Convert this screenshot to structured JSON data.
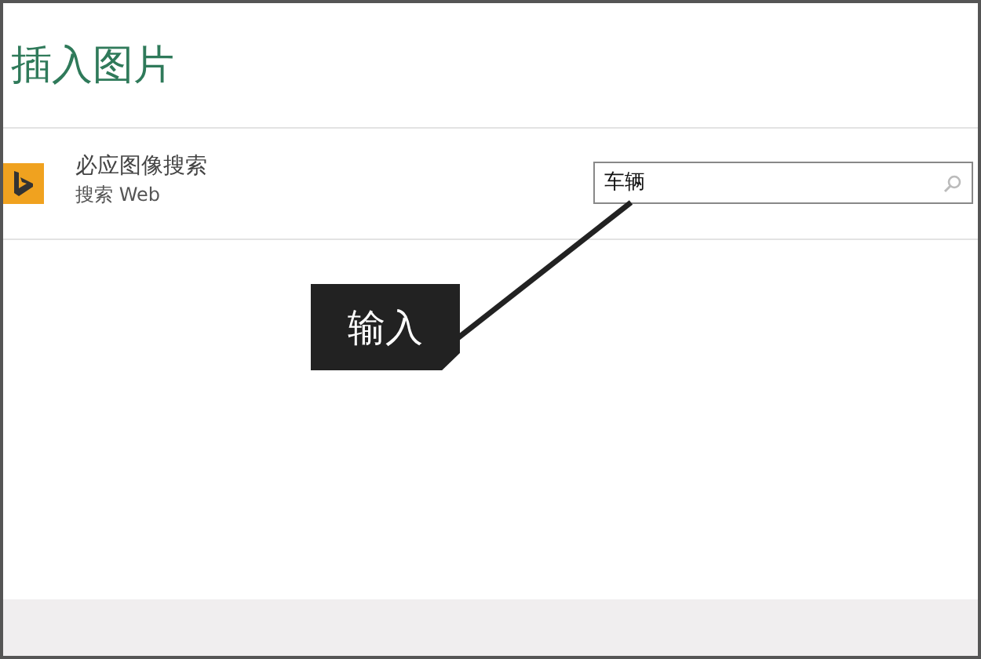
{
  "window": {
    "title": "插入图片"
  },
  "source": {
    "name": "必应图像搜索",
    "subtitle": "搜索 Web"
  },
  "search": {
    "value": "车辆"
  },
  "callout": {
    "text": "输入"
  }
}
